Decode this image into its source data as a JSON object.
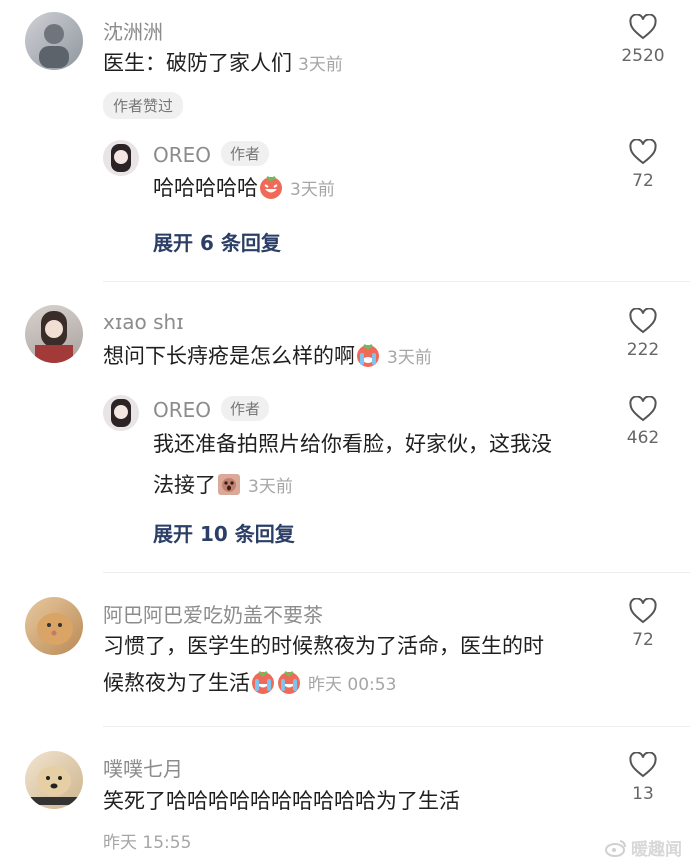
{
  "comments": [
    {
      "user": "沈洲洲",
      "text": "医生：破防了家人们",
      "time": "3天前",
      "likes": "2520",
      "badge": "作者赞过",
      "reply": {
        "user": "OREO",
        "tag": "作者",
        "text": "哈哈哈哈哈",
        "time": "3天前",
        "likes": "72"
      },
      "expand": "展开 6 条回复"
    },
    {
      "user": "xɪao shɪ",
      "text": "想问下长痔疮是怎么样的啊",
      "time": "3天前",
      "likes": "222",
      "reply": {
        "user": "OREO",
        "tag": "作者",
        "text_line1": "我还准备拍照片给你看脸，好家伙，这我没",
        "text_line2": "法接了",
        "time": "3天前",
        "likes": "462"
      },
      "expand": "展开 10 条回复"
    },
    {
      "user": "阿巴阿巴爱吃奶盖不要茶",
      "text_line1": "习惯了，医学生的时候熬夜为了活命，医生的时",
      "text_line2": "候熬夜为了生活",
      "time": "昨天 00:53",
      "likes": "72"
    },
    {
      "user": "噗噗七月",
      "text": "笑死了哈哈哈哈哈哈哈哈哈哈为了生活",
      "time": "昨天 15:55",
      "likes": "13"
    }
  ],
  "watermark": "暖趣闻",
  "colors": {
    "name": "#8c8c8c",
    "time": "#a6a6a6",
    "expand": "#2b3f66",
    "emoji": "#f06a5a"
  }
}
